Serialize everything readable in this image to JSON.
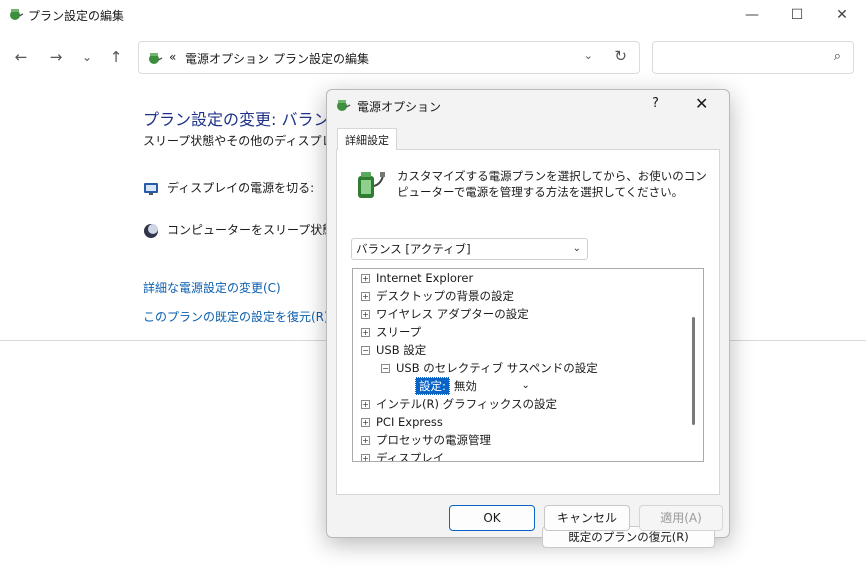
{
  "window": {
    "title": "プラン設定の編集",
    "minimize_icon": "—",
    "maximize_icon": "☐",
    "close_icon": "✕"
  },
  "nav": {
    "back": "←",
    "forward": "→",
    "recent": "⌄",
    "up": "↑",
    "address_prefix": "«",
    "address_items": [
      "電源オプション",
      "プラン設定の編集"
    ],
    "address_sep": "›",
    "address_dropdown": "⌄",
    "refresh": "↻",
    "search_value": "",
    "search_icon": "⌕"
  },
  "main": {
    "title": "プラン設定の変更: バランス",
    "description": "スリープ状態やその他のディスプレイ設定",
    "display_off_label": "ディスプレイの電源を切る:",
    "sleep_label": "コンピューターをスリープ状態にする:",
    "advanced_link": "詳細な電源設定の変更(C)",
    "restore_link": "このプランの既定の設定を復元(R)"
  },
  "dialog": {
    "title": "電源オプション",
    "help": "?",
    "close": "✕",
    "tab_label": "詳細設定",
    "description": "カスタマイズする電源プランを選択してから、お使いのコンピューターで電源を管理する方法を選択してください。",
    "plan_select": "バランス [アクティブ]",
    "tree": [
      {
        "toggle": "+",
        "label": "Internet Explorer"
      },
      {
        "toggle": "+",
        "label": "デスクトップの背景の設定"
      },
      {
        "toggle": "+",
        "label": "ワイヤレス アダプターの設定"
      },
      {
        "toggle": "+",
        "label": "スリープ"
      },
      {
        "toggle": "−",
        "label": "USB 設定"
      },
      {
        "toggle": "−",
        "label": "USB のセレクティブ サスペンドの設定"
      },
      {
        "setting_label": "設定:",
        "setting_value": "無効"
      },
      {
        "toggle": "+",
        "label": "インテル(R) グラフィックスの設定"
      },
      {
        "toggle": "+",
        "label": "PCI Express"
      },
      {
        "toggle": "+",
        "label": "プロセッサの電源管理"
      },
      {
        "toggle": "+",
        "label": "ディスプレイ"
      }
    ],
    "restore_defaults": "既定のプランの復元(R)",
    "ok": "OK",
    "cancel": "キャンセル",
    "apply": "適用(A)"
  },
  "colors": {
    "link": "#0c5fae",
    "title_blue": "#1e3287",
    "accent": "#0a64c8"
  },
  "icons": [
    "power-options-icon",
    "display-power-icon",
    "sleep-moon-icon",
    "battery-plug-icon"
  ]
}
